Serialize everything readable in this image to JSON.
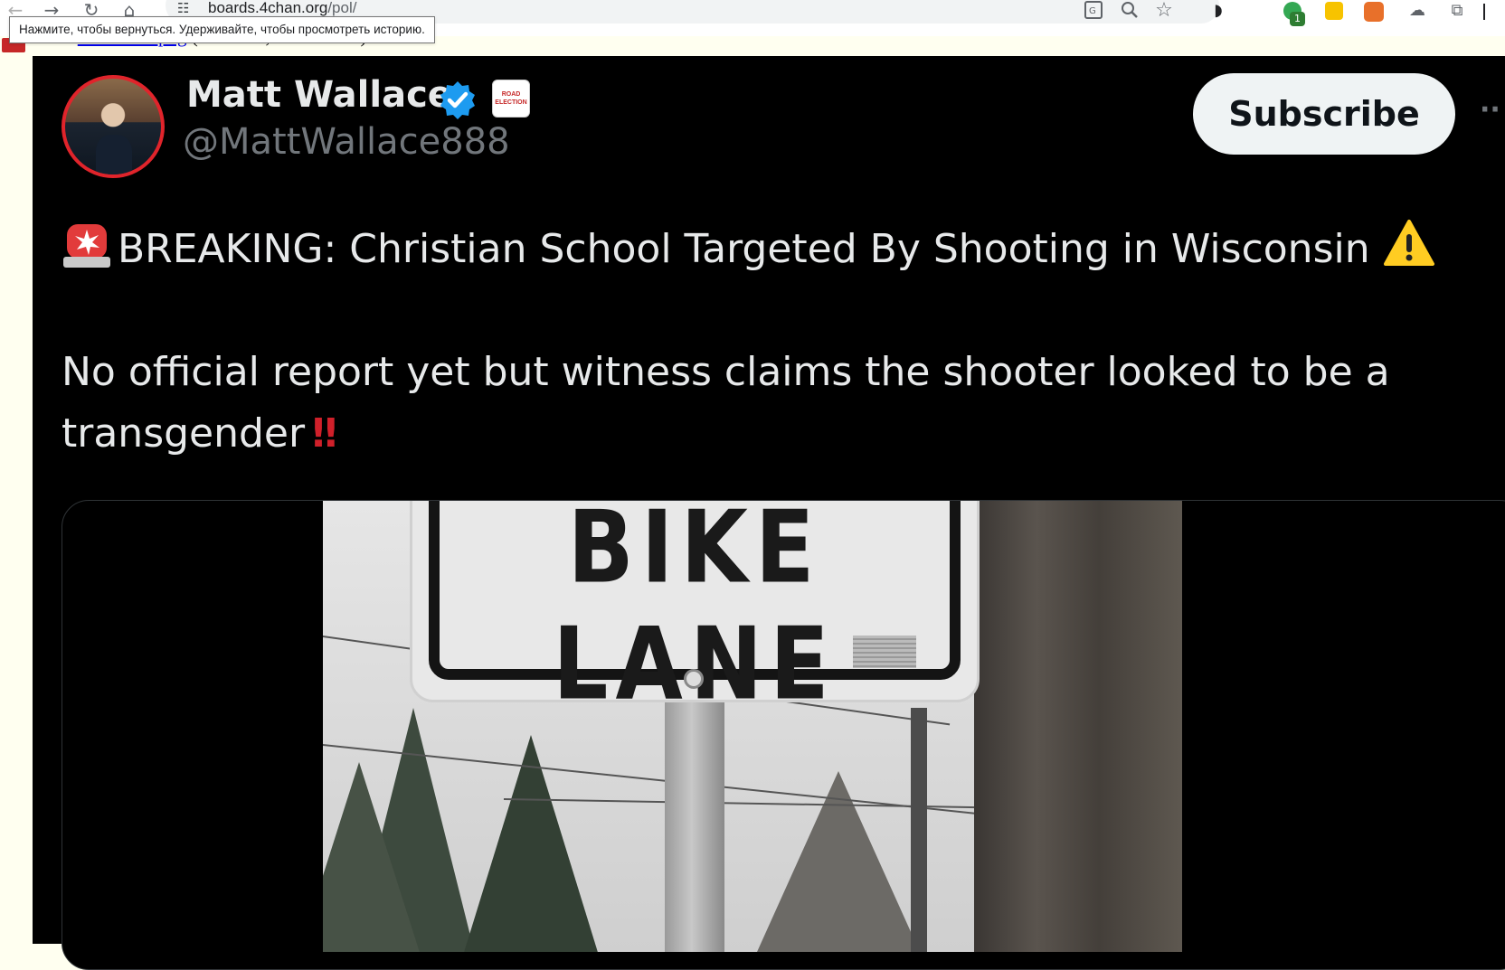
{
  "browser": {
    "url_host": "boards.4chan.org",
    "url_path": "/pol/",
    "tooltip": "Нажмите, чтобы вернуться. Удерживайте, чтобы просмотреть историю.",
    "extension_badge": "1"
  },
  "page": {
    "file_prefix": "File:",
    "file_name": "wisconsin.png",
    "file_info": "(1.08 MB, 1652x1402)"
  },
  "tweet": {
    "author_name": "Matt Wallace",
    "handle": "@MattWallace888",
    "affiliate_badge_text": "ROAD ELECTION",
    "subscribe_label": "Subscribe",
    "more_label": "··",
    "headline": "BREAKING: Christian School Targeted By Shooting in Wisconsin",
    "body_line1": "No official report yet but witness claims the shooter looked to be a",
    "body_line2": "transgender",
    "body_emoji": "‼",
    "verified_color": "#1d9bf0",
    "avatar_ring_color": "#e0242b"
  },
  "media": {
    "sign_text": "BIKE LANE"
  },
  "icons": [
    "back-icon",
    "forward-icon",
    "reload-icon",
    "home-icon",
    "site-info-icon",
    "translate-icon",
    "zoom-icon",
    "bookmark-star-icon",
    "extensions-puzzle-icon",
    "verified-badge-icon",
    "siren-emoji-icon",
    "warning-emoji-icon"
  ]
}
